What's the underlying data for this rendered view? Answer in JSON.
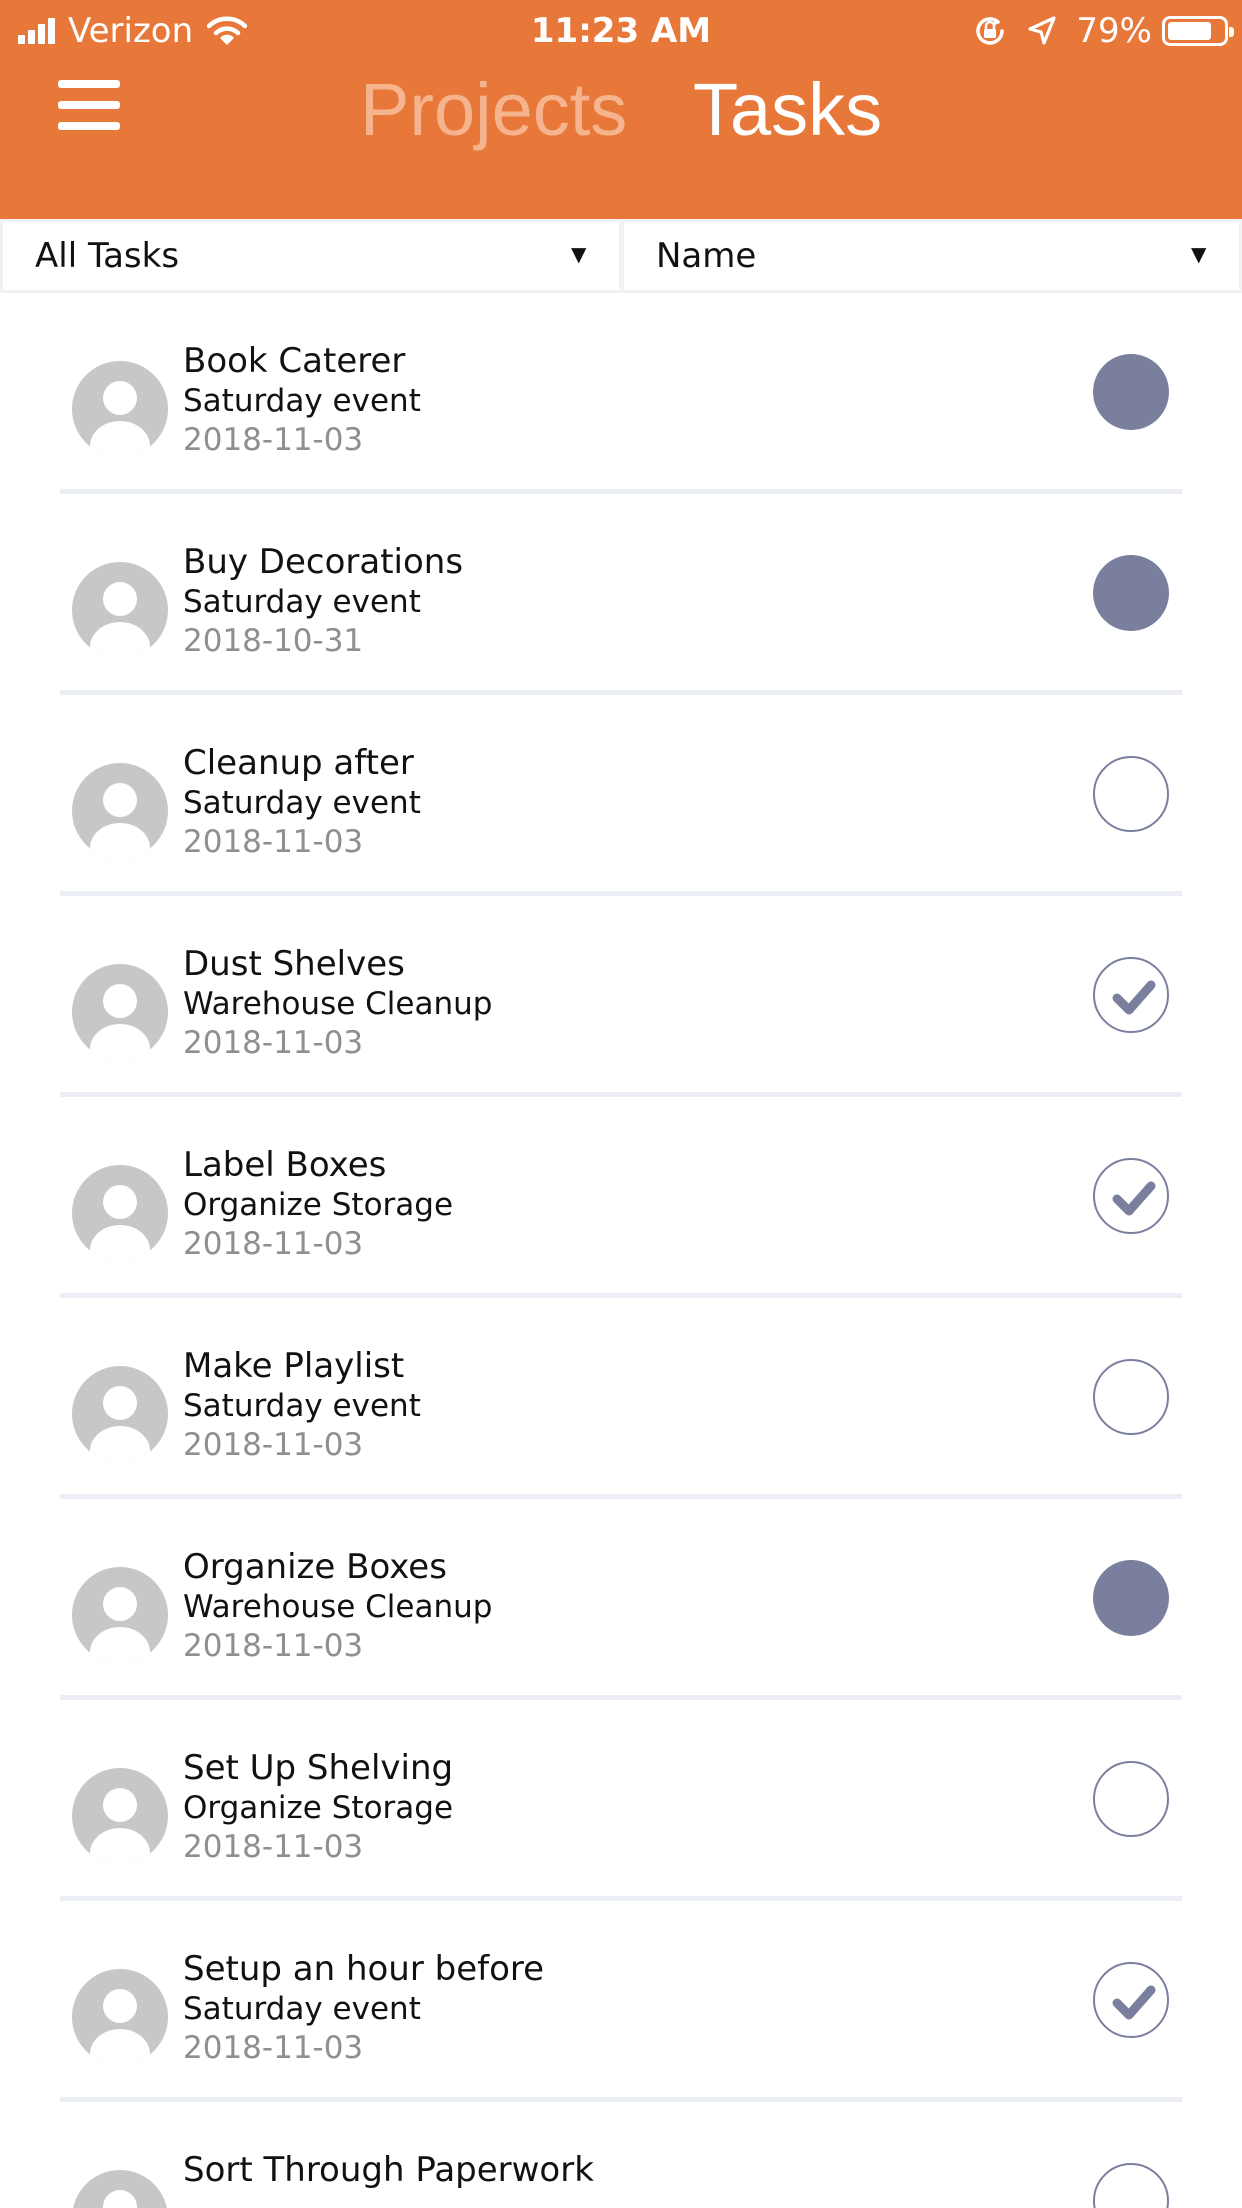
{
  "status_bar": {
    "carrier": "Verizon",
    "time": "11:23 AM",
    "battery_percent": "79%",
    "battery_level": 0.79,
    "icons": [
      "signal-icon",
      "wifi-icon",
      "orientation-lock-icon",
      "location-icon",
      "battery-icon"
    ]
  },
  "header": {
    "menu_icon": "hamburger-menu-icon",
    "tabs": [
      {
        "label": "Projects",
        "active": false
      },
      {
        "label": "Tasks",
        "active": true
      }
    ]
  },
  "filters": {
    "task_filter": "All Tasks",
    "sort_by": "Name"
  },
  "colors": {
    "header": "#E8783A",
    "inactive_tab": "#F5B48E",
    "status_circle": "#7B7F9E",
    "divider": "#EBEEF4"
  },
  "tasks": [
    {
      "title": "Book Caterer",
      "project": "Saturday event",
      "date": "2018-11-03",
      "status": "filled"
    },
    {
      "title": "Buy Decorations",
      "project": "Saturday event",
      "date": "2018-10-31",
      "status": "filled"
    },
    {
      "title": "Cleanup after",
      "project": "Saturday event",
      "date": "2018-11-03",
      "status": "open"
    },
    {
      "title": "Dust Shelves",
      "project": "Warehouse Cleanup",
      "date": "2018-11-03",
      "status": "done"
    },
    {
      "title": "Label Boxes",
      "project": "Organize Storage",
      "date": "2018-11-03",
      "status": "done"
    },
    {
      "title": "Make Playlist",
      "project": "Saturday event",
      "date": "2018-11-03",
      "status": "open"
    },
    {
      "title": "Organize Boxes",
      "project": "Warehouse Cleanup",
      "date": "2018-11-03",
      "status": "filled"
    },
    {
      "title": "Set Up Shelving",
      "project": "Organize Storage",
      "date": "2018-11-03",
      "status": "open"
    },
    {
      "title": "Setup an hour before",
      "project": "Saturday event",
      "date": "2018-11-03",
      "status": "done"
    },
    {
      "title": "Sort Through Paperwork",
      "project": "",
      "date": "",
      "status": "open"
    }
  ]
}
